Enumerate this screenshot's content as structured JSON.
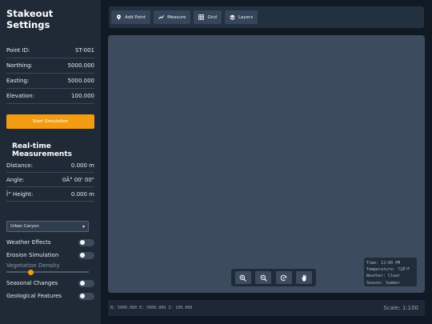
{
  "sidebar": {
    "title": "Stakeout Settings",
    "fields": [
      {
        "label": "Point ID:",
        "value": "ST-001"
      },
      {
        "label": "Northing:",
        "value": "5000.000"
      },
      {
        "label": "Easting:",
        "value": "5000.000"
      },
      {
        "label": "Elevation:",
        "value": "100.000"
      }
    ],
    "start_button": "Start Simulation",
    "measurements_title": "Real-time Measurements",
    "measurements": [
      {
        "label": "Distance:",
        "value": "0.000 m"
      },
      {
        "label": "Angle:",
        "value": "0Â° 00' 00\""
      },
      {
        "label": "Î” Height:",
        "value": "0.000 m"
      }
    ],
    "environment_select": "Urban Canyon",
    "toggles": [
      {
        "label": "Weather Effects",
        "on": false
      },
      {
        "label": "Erosion Simulation",
        "on": false
      }
    ],
    "vegetation_label": "Vegetation Density",
    "vegetation_level": 0.3,
    "toggles2": [
      {
        "label": "Seasonal Changes",
        "on": false
      },
      {
        "label": "Geological Features",
        "on": false
      }
    ]
  },
  "toolbar": {
    "buttons": [
      {
        "label": "Add Point",
        "icon": "pin-icon"
      },
      {
        "label": "Measure",
        "icon": "line-chart-icon"
      },
      {
        "label": "Grid",
        "icon": "grid-icon"
      },
      {
        "label": "Layers",
        "icon": "layers-icon"
      }
    ]
  },
  "environment": {
    "time": "Time: 12:00 PM",
    "temperature": "Temperature: 72Â°F",
    "weather": "Weather: Clear",
    "season": "Season: Summer"
  },
  "map_controls": [
    "zoom-in-icon",
    "zoom-out-icon",
    "rotate-icon",
    "pan-hand-icon"
  ],
  "status": {
    "coords": "N: 5000.000 E: 5000.000 Z: 100.000",
    "scale": "Scale: 1:100"
  },
  "colors": {
    "accent": "#f39c12",
    "sidebar": "#1f2a36",
    "canvas": "#3d4b5e"
  }
}
